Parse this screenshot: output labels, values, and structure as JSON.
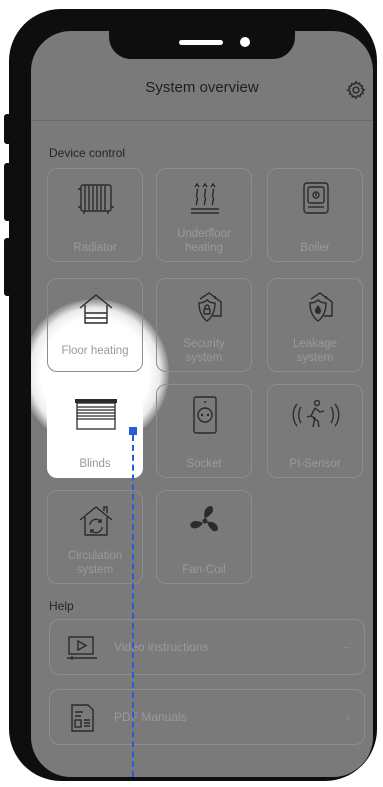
{
  "header": {
    "title": "System overview",
    "settings_icon": "gear-icon"
  },
  "device_control": {
    "section_label": "Device control",
    "tiles": [
      {
        "label": "Radiator",
        "icon": "radiator-icon"
      },
      {
        "label": "Underfloor\nheating",
        "icon": "underfloor-heating-icon"
      },
      {
        "label": "Boiler",
        "icon": "boiler-icon"
      },
      {
        "label": "Floor heating",
        "icon": "floor-heating-icon"
      },
      {
        "label": "Security\nsystem",
        "icon": "security-house-icon"
      },
      {
        "label": "Leakage\nsystem",
        "icon": "leakage-house-icon"
      },
      {
        "label": "Blinds",
        "icon": "blinds-icon",
        "highlighted": true
      },
      {
        "label": "Socket",
        "icon": "socket-icon"
      },
      {
        "label": "PI-Sensor",
        "icon": "motion-sensor-icon"
      },
      {
        "label": "Circulation\nsystem",
        "icon": "circulation-house-icon"
      },
      {
        "label": "Fan-Coil",
        "icon": "fan-icon"
      }
    ]
  },
  "help": {
    "section_label": "Help",
    "items": [
      {
        "label": "Video instructions",
        "icon": "video-icon",
        "chevron": "–"
      },
      {
        "label": "PDF Manuals",
        "icon": "pdf-document-icon",
        "chevron": "›"
      }
    ]
  },
  "colors": {
    "screen_bg": "#7a7a7a",
    "highlight": "#ffffff",
    "accent_marker": "#2a5bd7"
  }
}
